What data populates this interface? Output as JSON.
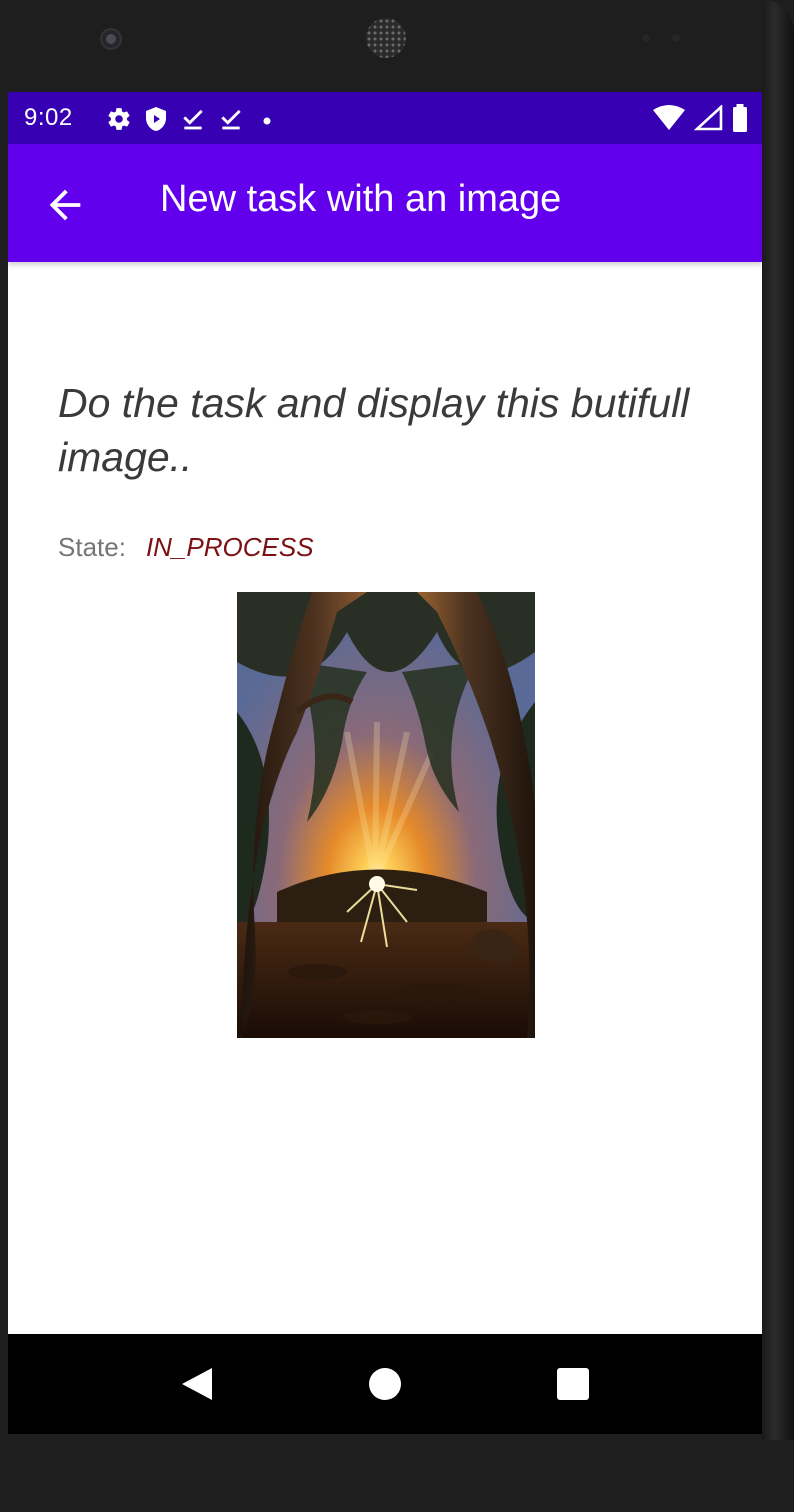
{
  "status_bar": {
    "time": "9:02",
    "left_icons": [
      "settings-icon",
      "shield-icon",
      "download-done-icon",
      "download-done-icon",
      "dot-icon"
    ],
    "right_icons": [
      "wifi-icon",
      "signal-icon",
      "battery-icon"
    ],
    "background": "#3700b3"
  },
  "app_bar": {
    "title": "New task with an image",
    "back_icon": "arrow-back-icon",
    "background": "#6200ee"
  },
  "task": {
    "description": "Do the task and display this butifull image..",
    "state_label": "State:",
    "state_value": "IN_PROCESS",
    "state_color": "#7b1113",
    "image": "forest-sunset-photo"
  },
  "nav_bar": {
    "buttons": [
      "back-triangle-icon",
      "home-circle-icon",
      "recents-square-icon"
    ]
  }
}
